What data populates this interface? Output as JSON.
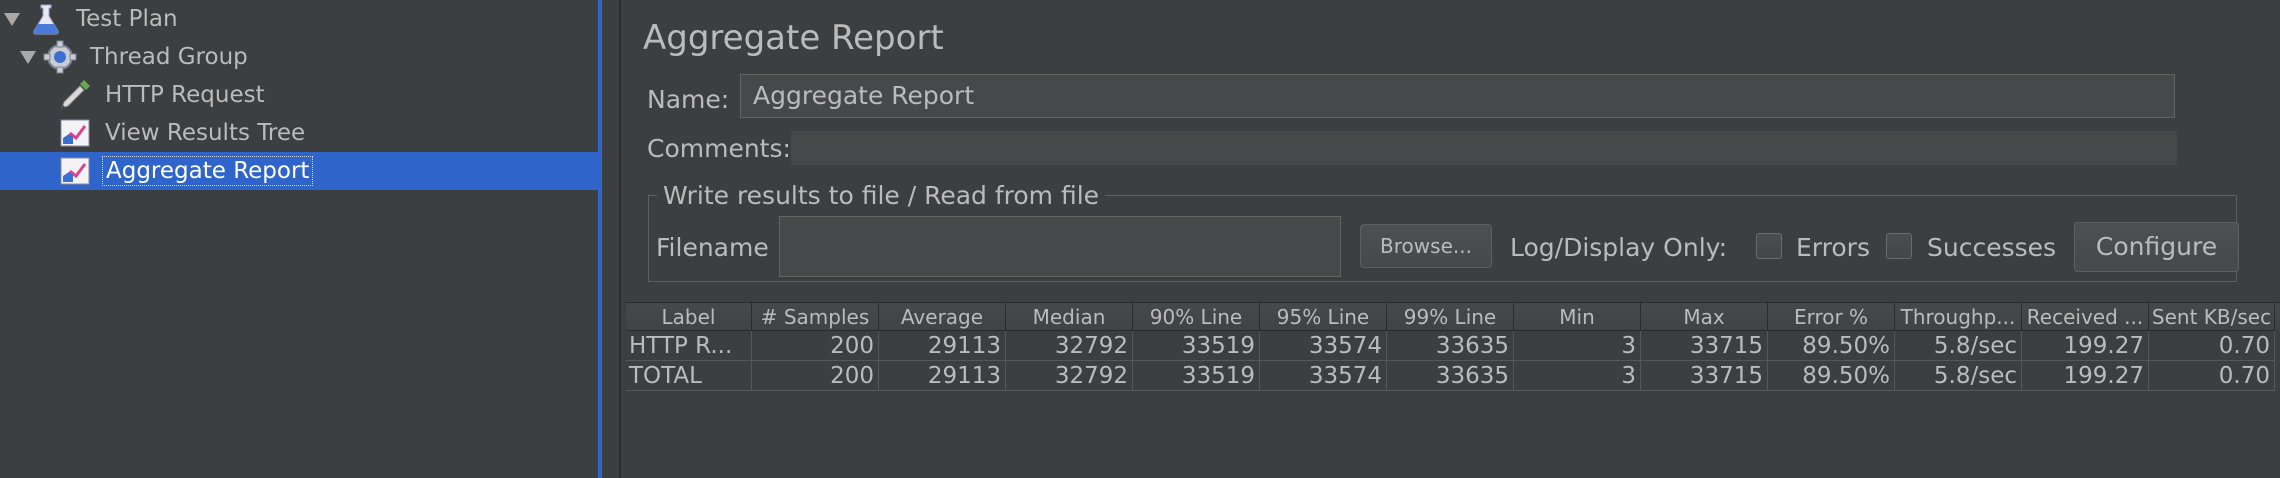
{
  "tree": {
    "items": [
      {
        "label": "Test Plan",
        "icon": "flask-icon",
        "expanded": true
      },
      {
        "label": "Thread Group",
        "icon": "gear-icon",
        "expanded": true
      },
      {
        "label": "HTTP Request",
        "icon": "pipette-icon"
      },
      {
        "label": "View Results Tree",
        "icon": "graph-icon"
      },
      {
        "label": "Aggregate Report",
        "icon": "graph-icon",
        "selected": true
      }
    ]
  },
  "panel": {
    "title": "Aggregate Report",
    "name_label": "Name:",
    "name_value": "Aggregate Report",
    "comments_label": "Comments:",
    "comments_value": "",
    "file_group_legend": "Write results to file / Read from file",
    "filename_label": "Filename",
    "filename_value": "",
    "browse_label": "Browse...",
    "log_display_label": "Log/Display Only:",
    "errors_label": "Errors",
    "errors_checked": false,
    "successes_label": "Successes",
    "successes_checked": false,
    "configure_label": "Configure"
  },
  "table": {
    "headers": [
      "Label",
      "# Samples",
      "Average",
      "Median",
      "90% Line",
      "95% Line",
      "99% Line",
      "Min",
      "Max",
      "Error %",
      "Throughp...",
      "Received ...",
      "Sent KB/sec"
    ],
    "rows": [
      [
        "HTTP R...",
        "200",
        "29113",
        "32792",
        "33519",
        "33574",
        "33635",
        "3",
        "33715",
        "89.50%",
        "5.8/sec",
        "199.27",
        "0.70"
      ],
      [
        "TOTAL",
        "200",
        "29113",
        "32792",
        "33519",
        "33574",
        "33635",
        "3",
        "33715",
        "89.50%",
        "5.8/sec",
        "199.27",
        "0.70"
      ]
    ]
  },
  "colors": {
    "background": "#3c3f41",
    "selection": "#2f65ca",
    "text": "#bbbbbb"
  }
}
